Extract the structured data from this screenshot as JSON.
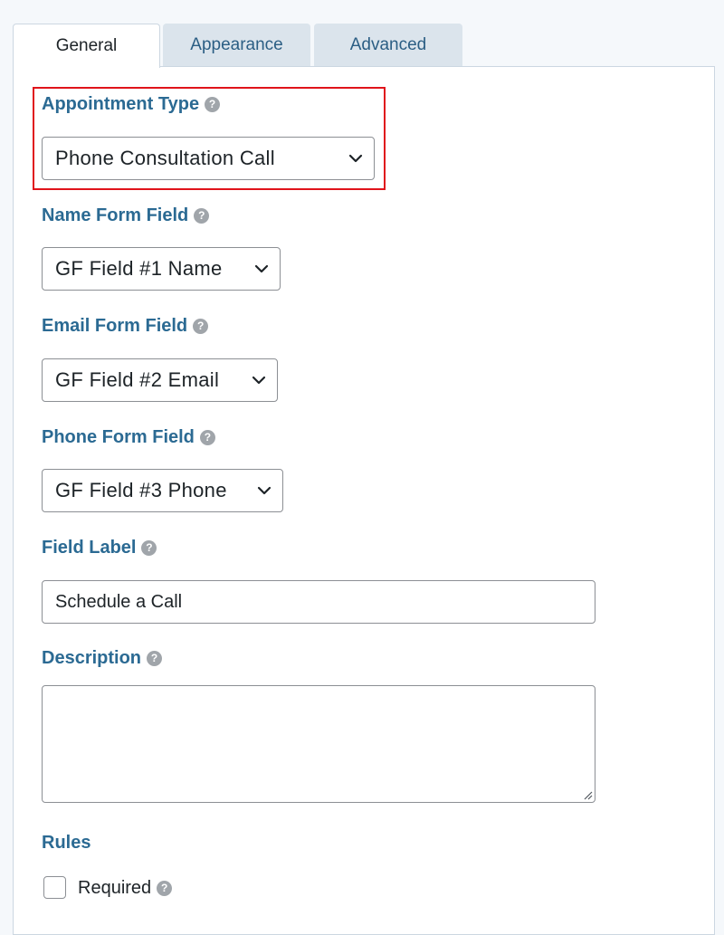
{
  "tabs": [
    {
      "label": "General",
      "active": true
    },
    {
      "label": "Appearance",
      "active": false
    },
    {
      "label": "Advanced",
      "active": false
    }
  ],
  "help_glyph": "?",
  "fields": {
    "appointment_type": {
      "label": "Appointment Type",
      "value": "Phone Consultation Call"
    },
    "name_form_field": {
      "label": "Name Form Field",
      "value": "GF Field #1 Name"
    },
    "email_form_field": {
      "label": "Email Form Field",
      "value": "GF Field #2 Email"
    },
    "phone_form_field": {
      "label": "Phone Form Field",
      "value": "GF Field #3 Phone"
    },
    "field_label": {
      "label": "Field Label",
      "value": "Schedule a Call"
    },
    "description": {
      "label": "Description",
      "value": ""
    }
  },
  "rules": {
    "label": "Rules",
    "required": {
      "label": "Required",
      "checked": false
    }
  },
  "colors": {
    "label_text": "#2b6a93",
    "highlight_border": "#e0141b",
    "inactive_tab_bg": "#dbe4ec",
    "help_icon": "#a0a5aa"
  },
  "icons": {
    "help": "question-circle-icon",
    "select": "chevron-down-icon",
    "resize": "resize-grip-icon"
  }
}
